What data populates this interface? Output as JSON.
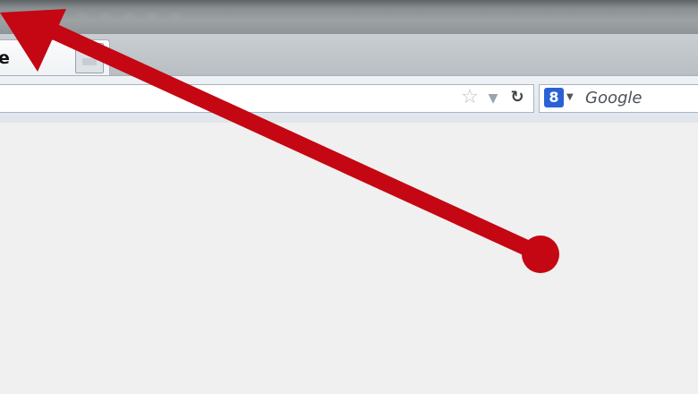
{
  "browser": {
    "tab_title": "e",
    "search_placeholder": "Google",
    "search_engine_letter": "8"
  },
  "icons": {
    "bookmark": "star-icon",
    "history": "chevron-down-icon",
    "reload": "reload-icon",
    "search_engine": "search-engine-icon"
  },
  "annotation": {
    "type": "arrow",
    "color": "#c40712",
    "from": "content area (dot)",
    "to": "top-left corner (tab)"
  },
  "colors": {
    "accent": "#c40712",
    "search_engine": "#2a62d6"
  }
}
